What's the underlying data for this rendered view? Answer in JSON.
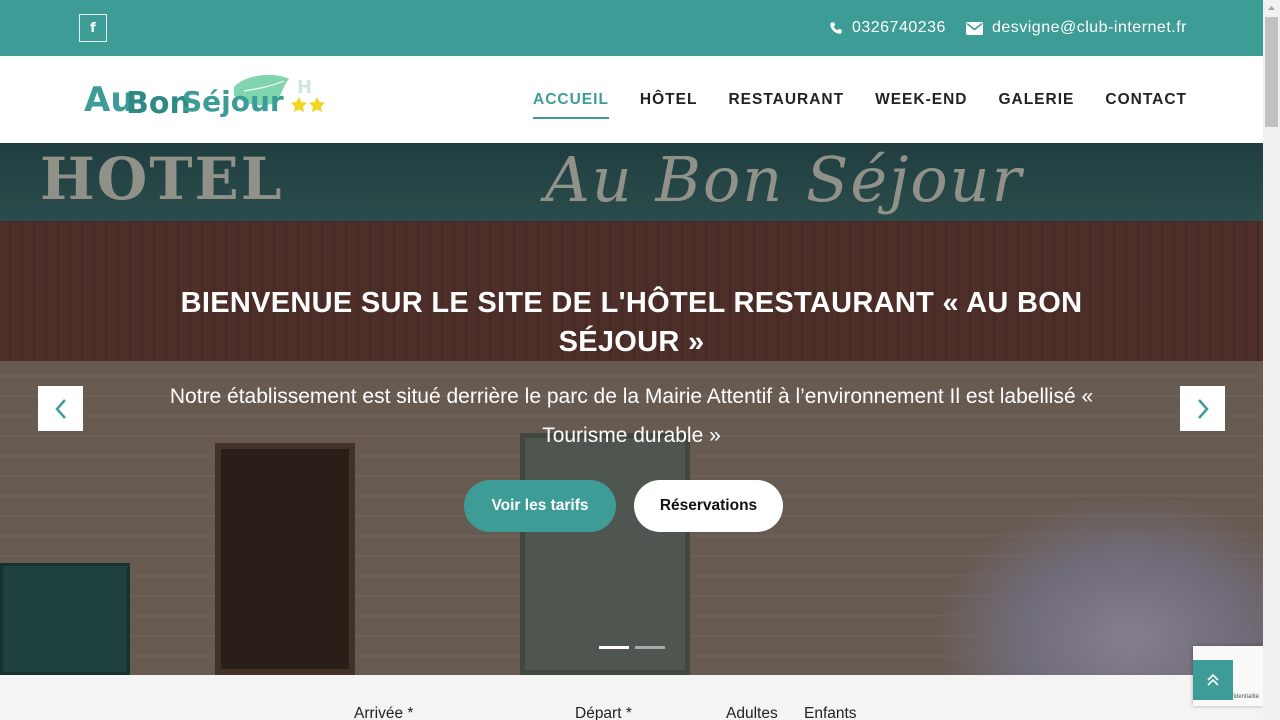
{
  "topbar": {
    "facebook_icon": "f",
    "phone": "0326740236",
    "email": "desvigne@club-internet.fr"
  },
  "logo": {
    "text_au": "Au",
    "text_bon": "Bon",
    "text_sejour": "Séjour",
    "badge": "H"
  },
  "nav": {
    "items": [
      {
        "label": "ACCUEIL",
        "active": true
      },
      {
        "label": "HÔTEL",
        "active": false
      },
      {
        "label": "RESTAURANT",
        "active": false
      },
      {
        "label": "WEEK-END",
        "active": false
      },
      {
        "label": "GALERIE",
        "active": false
      },
      {
        "label": "CONTACT",
        "active": false
      }
    ]
  },
  "hero": {
    "title": "BIENVENUE SUR LE SITE DE L'HÔTEL RESTAURANT « AU BON SÉJOUR »",
    "subtitle": "Notre établissement est situé derrière le parc de la Mairie Attentif à l’environnement Il est labellisé « Tourisme durable »",
    "btn_tarifs": "Voir les tarifs",
    "btn_reservations": "Réservations",
    "sign_left": "HOTEL",
    "sign_right": "Au Bon Séjour",
    "slides_total": 2,
    "slide_active": 1
  },
  "booking": {
    "arrivee": "Arrivée *",
    "depart": "Départ *",
    "adultes": "Adultes",
    "enfants": "Enfants"
  },
  "recaptcha": {
    "text": "Confidentialité"
  },
  "colors": {
    "accent": "#3d9d96",
    "nav_text": "#222222"
  }
}
